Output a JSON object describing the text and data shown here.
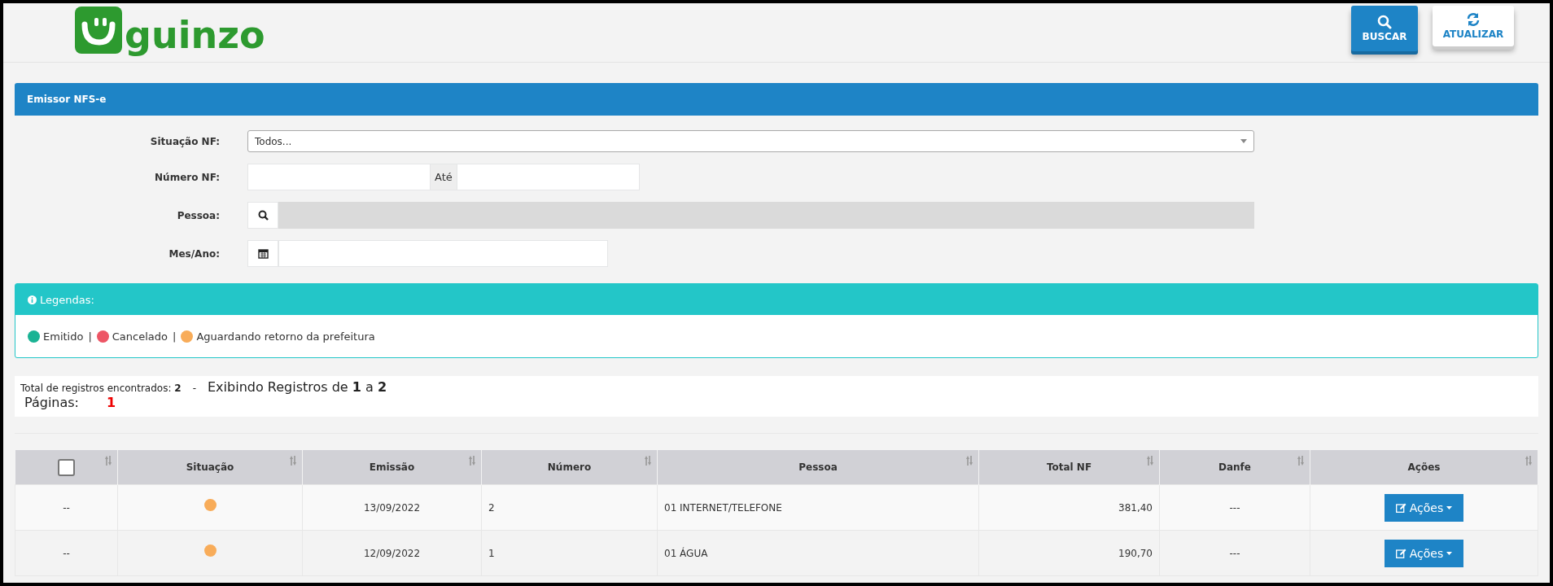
{
  "header": {
    "logo_text": "guinzo",
    "buttons": [
      {
        "kind": "search",
        "label": "BUSCAR"
      },
      {
        "kind": "refresh",
        "label": "ATUALIZAR"
      }
    ]
  },
  "panel": {
    "title": "Emissor NFS-e"
  },
  "form": {
    "situacao": {
      "label": "Situação NF:",
      "value": "Todos..."
    },
    "numero": {
      "label": "Número NF:",
      "addon": "Até"
    },
    "pessoa": {
      "label": "Pessoa:"
    },
    "mes_ano": {
      "label": "Mes/Ano:"
    }
  },
  "legend": {
    "title": "Legendas:",
    "items": [
      {
        "label": "Emitido",
        "color": "#1ab394"
      },
      {
        "label": "Cancelado",
        "color": "#ed5565"
      },
      {
        "label": "Aguardando retorno da prefeitura",
        "color": "#f8ac59"
      }
    ],
    "separator": "|"
  },
  "results": {
    "total": "Total de registros encontrados: **2**",
    "separator": "-",
    "showing": "Exibindo Registros de **1** a **2**",
    "pages_label": "Páginas:",
    "pages": [
      {
        "label": "1",
        "selected": true
      }
    ]
  },
  "table": {
    "select_all": {
      "checked": false
    },
    "columns": [
      "Situação",
      "Emissão",
      "Número",
      "Pessoa",
      "Total NF",
      "Danfe",
      "Ações"
    ],
    "rows": [
      {
        "col_1": "--",
        "color": "#f8ac59",
        "emissao": "13/09/2022",
        "numero": "2",
        "pessoa": "01 INTERNET/TELEFONE",
        "total": "381,40",
        "danfe": "---",
        "action": "Ações"
      },
      {
        "col_1": "--",
        "color": "#f8ac59",
        "emissao": "12/09/2022",
        "numero": "1",
        "pessoa": "01 ÁGUA",
        "total": "190,70",
        "danfe": "---",
        "action": "Ações"
      }
    ]
  }
}
